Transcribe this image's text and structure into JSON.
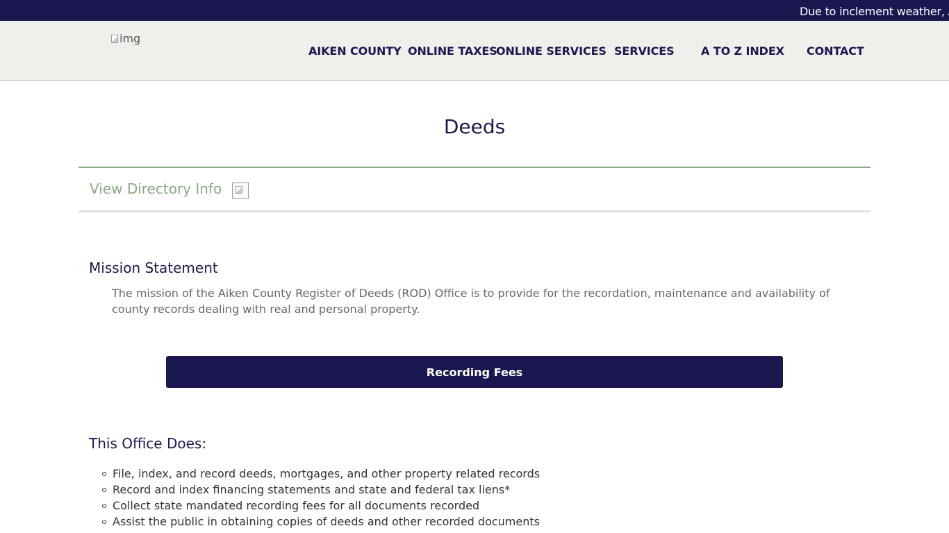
{
  "alert": {
    "text": "Due to inclement weather, A"
  },
  "header": {
    "logo_alt": "img",
    "nav": [
      {
        "label": "AIKEN COUNTY"
      },
      {
        "label": "ONLINE TAXES"
      },
      {
        "label": "ONLINE SERVICES"
      },
      {
        "label": "SERVICES"
      },
      {
        "label": "A TO Z INDEX"
      },
      {
        "label": "CONTACT"
      }
    ]
  },
  "main": {
    "title": "Deeds",
    "directory_link": "View Directory Info",
    "mission": {
      "heading": "Mission Statement",
      "text": "The mission of the Aiken County Register of Deeds (ROD) Office is to provide for the recordation, maintenance and availability of county records dealing with real and personal property."
    },
    "fees_button": "Recording Fees",
    "duties": {
      "heading": "This Office Does:",
      "items": [
        "File, index, and record deeds, mortgages, and other property related records",
        "Record and index financing statements and state and federal tax liens*",
        "Collect state mandated recording fees for all documents recorded",
        "Assist the public in obtaining copies of deeds and other recorded documents"
      ]
    }
  },
  "colors": {
    "navy": "#1b1851",
    "header_bg": "#efefeb",
    "accent_green": "#8cb084",
    "text_gray": "#666666"
  }
}
